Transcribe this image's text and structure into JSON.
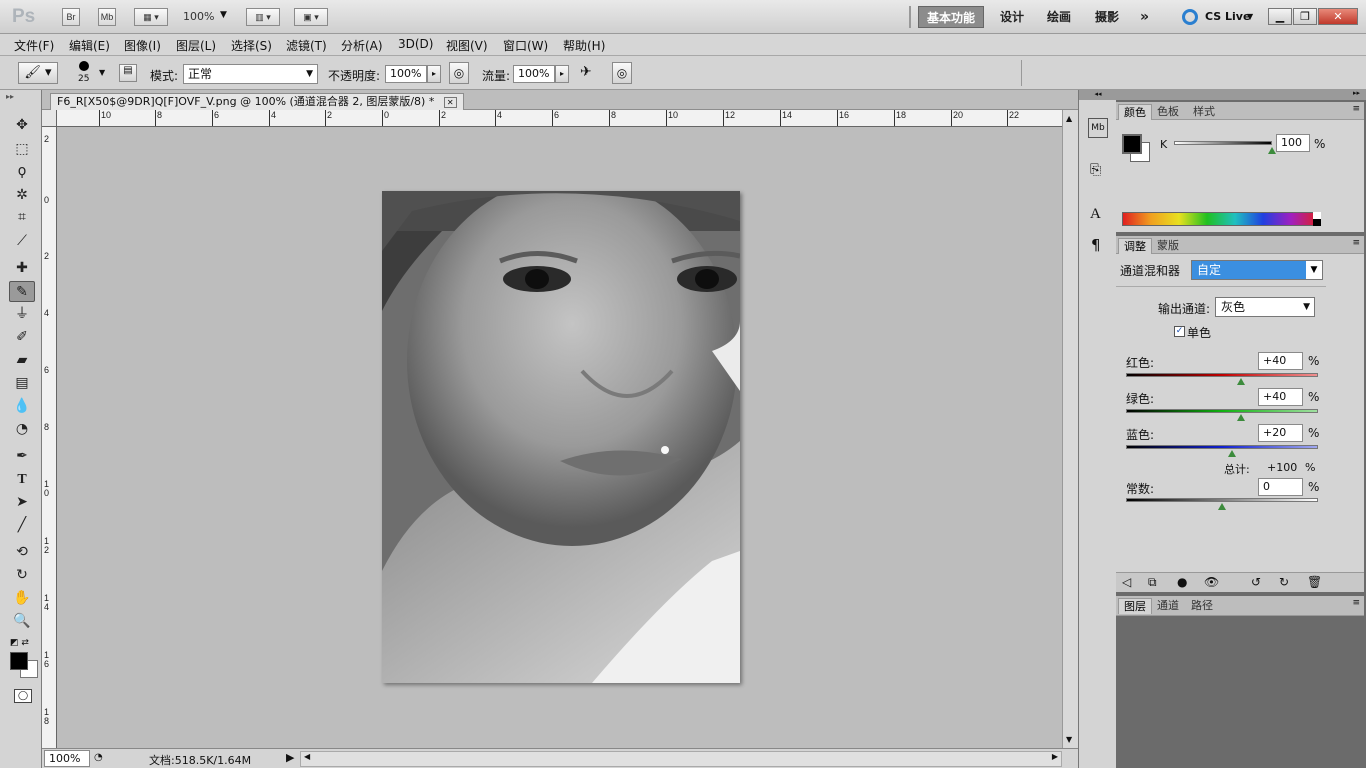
{
  "appbar": {
    "logo": "Ps",
    "br_label": "Br",
    "mb_label": "Mb",
    "zoom": "100%",
    "workspaces": [
      "基本功能",
      "设计",
      "绘画",
      "摄影"
    ],
    "more": "»",
    "cs_live": "CS Live"
  },
  "menu": [
    "文件(F)",
    "编辑(E)",
    "图像(I)",
    "图层(L)",
    "选择(S)",
    "滤镜(T)",
    "分析(A)",
    "3D(D)",
    "视图(V)",
    "窗口(W)",
    "帮助(H)"
  ],
  "options": {
    "brush_size": "25",
    "mode_label": "模式:",
    "mode_value": "正常",
    "opacity_label": "不透明度:",
    "opacity_value": "100%",
    "flow_label": "流量:",
    "flow_value": "100%"
  },
  "document": {
    "tab_title": "F6_R[X50$@9DR]Q[F]OVF_V.png @ 100% (通道混合器 2, 图层蒙版/8) *",
    "ruler_h": [
      "10",
      "8",
      "6",
      "4",
      "2",
      "0",
      "2",
      "4",
      "6",
      "8",
      "10",
      "12",
      "14",
      "16",
      "18",
      "20",
      "22"
    ],
    "ruler_v": [
      "2",
      "0",
      "2",
      "4",
      "6",
      "8",
      "10",
      "12",
      "14",
      "16",
      "18"
    ],
    "status_zoom": "100%",
    "status_doc": "文档:518.5K/1.64M"
  },
  "color_panel": {
    "tabs": [
      "颜色",
      "色板",
      "样式"
    ],
    "channel": "K",
    "value": "100",
    "unit": "%",
    "k_level": 1.0
  },
  "adjust_panel": {
    "tabs": [
      "调整",
      "蒙版"
    ],
    "title": "通道混和器",
    "preset": "自定",
    "output_label": "输出通道:",
    "output_value": "灰色",
    "mono_label": "单色",
    "channels": [
      {
        "label": "红色:",
        "value": "+40",
        "unit": "%",
        "level": 0.6
      },
      {
        "label": "绿色:",
        "value": "+40",
        "unit": "%",
        "level": 0.6
      },
      {
        "label": "蓝色:",
        "value": "+20",
        "unit": "%",
        "level": 0.55
      }
    ],
    "total_label": "总计:",
    "total_value": "+100",
    "total_unit": "%",
    "constant_label": "常数:",
    "constant_value": "0",
    "constant_unit": "%",
    "constant_level": 0.5
  },
  "layers_panel": {
    "tabs": [
      "图层",
      "通道",
      "路径"
    ]
  },
  "colors": {
    "accent": "#3b8fe0",
    "canvas_bg": "#bdbdbd"
  }
}
